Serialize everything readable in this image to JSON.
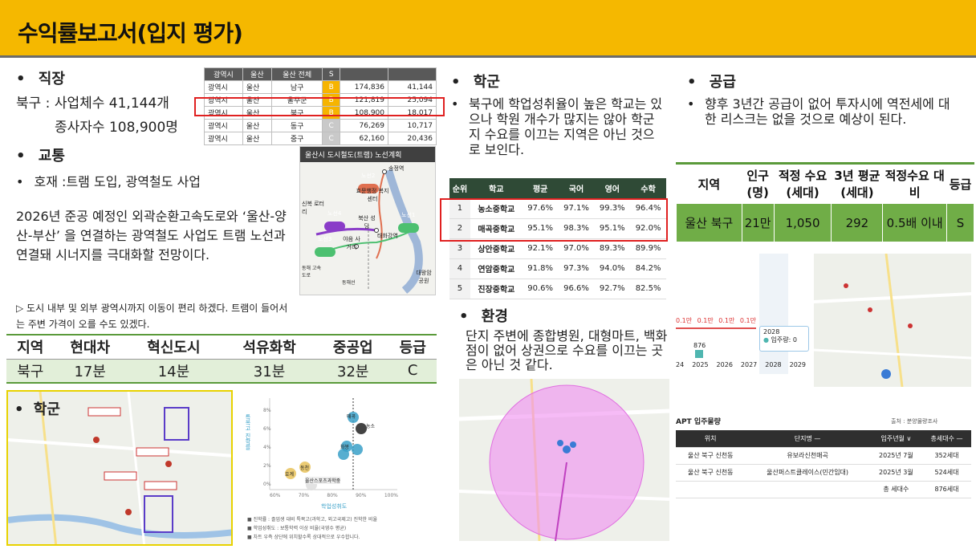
{
  "title": "수익률보고서(입지 평가)",
  "left": {
    "job_heading": "직장",
    "job_line1": "북구 : 사업체수 41,144개",
    "job_line2": "종사자수 108,900명",
    "traffic_heading": "교통",
    "traffic_line": "호재 :트램 도입, 광역철도 사업",
    "traffic_para": "2026년 준공 예정인 외곽순환고속도로와 ‘울산-양산-부산’ 을 연결하는 광역철도 사업도 트램 노선과 연결돼 시너지를 극대화할 전망이다.",
    "traffic_note": "▷ 도시 내부 및 외부 광역시까지 이동이 편리 하겠다. 트램이 들어서는 주변 가격이 오를 수도 있겠다.",
    "school_heading": "학군"
  },
  "biz_table": {
    "header": [
      "광역시",
      "울산",
      "울산 전체",
      "S",
      "",
      ""
    ],
    "rows": [
      [
        "광역시",
        "울산",
        "남구",
        "B",
        "174,836",
        "41,144"
      ],
      [
        "광역시",
        "울산",
        "울주군",
        "B",
        "121,819",
        "25,094"
      ],
      [
        "광역시",
        "울산",
        "북구",
        "B",
        "108,900",
        "18,017"
      ],
      [
        "광역시",
        "울산",
        "동구",
        "C",
        "76,269",
        "10,717"
      ],
      [
        "광역시",
        "울산",
        "중구",
        "C",
        "62,160",
        "20,436"
      ]
    ]
  },
  "tram_map": {
    "title": "울산시 도시철도(트램) 노선계획",
    "labels": [
      "송정역",
      "노선2",
      "효문행정 복지센터",
      "신복 로터리",
      "노선4",
      "북산 성당",
      "태화강역",
      "노선1",
      "노선3",
      "야음 사거리",
      "대왕암 공원",
      "동해선",
      "동해 고속도로"
    ]
  },
  "traffic_table": {
    "headers": [
      "지역",
      "현대차",
      "혁신도시",
      "석유화학",
      "중공업",
      "등급"
    ],
    "row": [
      "북구",
      "17분",
      "14분",
      "31분",
      "32분",
      "C"
    ]
  },
  "school": {
    "heading": "학군",
    "text": "북구에 학업성취율이 높은 학교는 있으나 학원 개수가 많지는 않아 학군지 수요를 이끄는 지역은 아닌 것으로 보인다.",
    "table_headers": [
      "순위",
      "학교",
      "평균",
      "국어",
      "영어",
      "수학"
    ],
    "rows": [
      [
        "1",
        "농소중학교",
        "97.6%",
        "97.1%",
        "99.3%",
        "96.4%"
      ],
      [
        "2",
        "매곡중학교",
        "95.1%",
        "98.3%",
        "95.1%",
        "92.0%"
      ],
      [
        "3",
        "상안중학교",
        "92.1%",
        "97.0%",
        "89.3%",
        "89.9%"
      ],
      [
        "4",
        "연암중학교",
        "91.8%",
        "97.3%",
        "94.0%",
        "84.2%"
      ],
      [
        "5",
        "진장중학교",
        "90.6%",
        "96.6%",
        "92.7%",
        "82.5%"
      ]
    ]
  },
  "scatter": {
    "xlabel": "학업성취도",
    "ylabel": "특목고 진학률",
    "x_ticks": [
      "60%",
      "70%",
      "80%",
      "90%",
      "100%"
    ],
    "y_ticks": [
      "0%",
      "2%",
      "4%",
      "6%",
      "8%"
    ],
    "legend": [
      "진학률 : 졸업생 대비 특목고(과학고, 외고국제고) 진학한 비율",
      "학업성취도 : 보통학력 이상 비율(국영수 평균)",
      "차트 우측 상단에 위치할수록 상대적으로 우수합니다."
    ],
    "point_labels": [
      "울산스포츠과학중",
      "호계",
      "동천",
      "농소",
      "매곡",
      "화봉"
    ]
  },
  "environment": {
    "heading": "환경",
    "text": "단지 주변에 종합병원, 대형마트, 백화점이 없어 상권으로 수요를 이끄는 곳은 아닌 것 같다."
  },
  "supply": {
    "heading": "공급",
    "text": "향후 3년간 공급이 없어 투자시에 역전세에 대한 리스크는 없을 것으로 예상이 된다.",
    "table_headers": [
      "지역",
      "인구 (명)",
      "적정 수요 (세대)",
      "3년 평균 (세대)",
      "적정수요 대비",
      "등급"
    ],
    "row": [
      "울산 북구",
      "21만",
      "1,050",
      "292",
      "0.5배 이내",
      "S"
    ]
  },
  "supply_chart": {
    "bar_labels": [
      "0.1만",
      "0.1만",
      "0.1만",
      "0.1만"
    ],
    "value_label": "876",
    "x_ticks": [
      "24",
      "2025",
      "2026",
      "2027",
      "2028",
      "2029"
    ],
    "tooltip_year": "2028",
    "tooltip_text": "입주량: 0"
  },
  "apt": {
    "title": "APT 입주물량",
    "source": "출처 : 분양물량조사",
    "headers": [
      "위치",
      "단지명 —",
      "입주년월 ∨",
      "총세대수 —"
    ],
    "rows": [
      [
        "울산 북구 신천동",
        "유보라신천매곡",
        "2025년 7월",
        "352세대"
      ],
      [
        "울산 북구 신천동",
        "울산퍼스트클레이스(민간임대)",
        "2025년 3월",
        "524세대"
      ],
      [
        "",
        "",
        "총 세대수",
        "876세대"
      ]
    ]
  },
  "colors": {
    "title_bg": "#f5b800",
    "highlight_red": "#e02020",
    "green": "#70ad47",
    "light_green": "#e2efd9",
    "pink_area": "#f08ef0"
  }
}
